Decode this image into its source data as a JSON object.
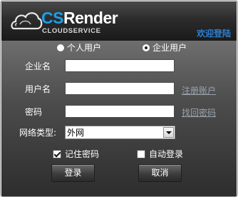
{
  "header": {
    "brand_cs": "CS",
    "brand_render": "Render",
    "brand_sub": "CLOUDSERVICE",
    "welcome": "欢迎登陆"
  },
  "account_type": {
    "personal_label": "个人用户",
    "enterprise_label": "企业用户",
    "selected": "enterprise"
  },
  "form": {
    "company_label": "企业名",
    "company_value": "",
    "username_label": "用户名",
    "username_value": "",
    "register_link": "注册账户",
    "password_label": "密码",
    "password_value": "",
    "recover_link": "找回密码",
    "network_label": "网络类型:",
    "network_value": "外网"
  },
  "options": {
    "remember_label": "记住密码",
    "remember_checked": true,
    "autologin_label": "自动登录",
    "autologin_checked": false
  },
  "buttons": {
    "login": "登录",
    "cancel": "取消"
  },
  "colors": {
    "accent_blue": "#1aa0e8",
    "welcome_blue": "#2d7fd0",
    "link_gray": "#9ca4ad"
  }
}
